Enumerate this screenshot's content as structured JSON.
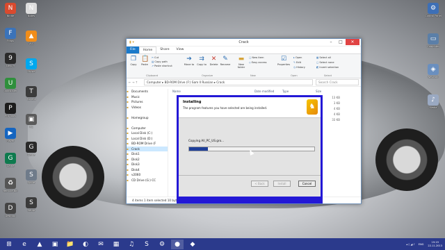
{
  "desktop": {
    "left_icons": [
      {
        "label": "Ninite",
        "glyph": "N",
        "color": "#d94a2e"
      },
      {
        "label": "Fraps",
        "glyph": "F",
        "color": "#3b73b9"
      },
      {
        "label": "Nero 9",
        "glyph": "9",
        "color": "#2a2a2a"
      },
      {
        "label": "uninstaller",
        "glyph": "U",
        "color": "#2f8f3c"
      },
      {
        "label": "Pro Tools",
        "glyph": "P",
        "color": "#1c1c1c"
      },
      {
        "label": "Player",
        "glyph": "▶",
        "color": "#1565c0"
      },
      {
        "label": "Game",
        "glyph": "G",
        "color": "#0e7a4e"
      },
      {
        "label": "Recycle Bin",
        "glyph": "♻",
        "color": "#555"
      },
      {
        "label": "Desktop",
        "glyph": "D",
        "color": "#444"
      }
    ],
    "second_icons": [
      {
        "label": "Notes",
        "glyph": "N",
        "color": "#ddd"
      },
      {
        "label": "VLC",
        "glyph": "▲",
        "color": "#f08d1a"
      },
      {
        "label": "Skype",
        "glyph": "S",
        "color": "#00a8ee"
      },
      {
        "label": "Torrent",
        "glyph": "T",
        "color": "#3c3c3c"
      },
      {
        "label": "PC",
        "glyph": "▣",
        "color": "#5b5b5b"
      },
      {
        "label": "Game",
        "glyph": "G",
        "color": "#2a2a2a"
      },
      {
        "label": "Spore",
        "glyph": "S",
        "color": "#6f7b8a"
      },
      {
        "label": "Setup",
        "glyph": "S",
        "color": "#3b3b3b"
      }
    ],
    "right_icons": [
      {
        "label": "Control Panel",
        "glyph": "⚙",
        "color": "#3d6fb6"
      },
      {
        "label": "Computer",
        "glyph": "▭",
        "color": "#5b7fa8"
      },
      {
        "label": "Network",
        "glyph": "◈",
        "color": "#6a8fbf"
      },
      {
        "label": "Media",
        "glyph": "♪",
        "color": "#9aa9c2"
      }
    ]
  },
  "explorer": {
    "title": "Crack",
    "tabs": [
      "File",
      "Home",
      "Share",
      "View"
    ],
    "selected_tab": "Home",
    "ribbon": {
      "copy": "Copy",
      "paste": "Paste",
      "cut": "Cut",
      "copy_path": "Copy path",
      "paste_shortcut": "Paste shortcut",
      "move_to": "Move to",
      "copy_to": "Copy to",
      "delete": "Delete",
      "rename": "Rename",
      "new_folder": "New folder",
      "new_item": "New item",
      "easy_access": "Easy access",
      "properties": "Properties",
      "open": "Open",
      "edit": "Edit",
      "history": "History",
      "select_all": "Select all",
      "select_none": "Select none",
      "invert_selection": "Invert selection",
      "groups": [
        "Clipboard",
        "Organize",
        "New",
        "Open",
        "Select"
      ]
    },
    "address_path": "Computer  ▸  BD-ROM Drive (F:) Sam II Russian  ▸  Crack",
    "search_placeholder": "Search Crack",
    "nav_items": [
      "Documents",
      "Music",
      "Pictures",
      "Videos",
      "",
      "Homegroup",
      "",
      "Computer",
      "Local Disk (C:)",
      "Local Disk (D:)",
      "BD-ROM Drive (F",
      "Crack",
      "Disk1",
      "Disk2",
      "Disk3",
      "Disk4",
      "v2060",
      "CD Drive (G:) CC"
    ],
    "columns": {
      "name": "Name",
      "date": "Date modified",
      "type": "Type",
      "size": "Size"
    },
    "files": [
      {
        "name": "",
        "size": "13 KB"
      },
      {
        "name": "",
        "size": "3 KB"
      },
      {
        "name": "",
        "size": "4 KB"
      },
      {
        "name": "",
        "size": "4 KB"
      },
      {
        "name": "",
        "size": "33 KB"
      }
    ],
    "status": "4 items     1 item selected  10 byt"
  },
  "installer": {
    "heading": "Installing",
    "subheading": "The program features you have selected are being installed.",
    "status_text": "Copying All_PC_US.gro...",
    "progress": 0.15,
    "back_label": "< Back",
    "install_label": "Install",
    "cancel_label": "Cancel"
  },
  "taskbar": {
    "items": [
      "⊞",
      "e",
      "▲",
      "▣",
      "📁",
      "◐",
      "✉",
      "▦",
      "♫",
      "S",
      "⚙",
      "●",
      "◆"
    ],
    "active_index": 11,
    "tray": {
      "lang": "ENG",
      "time": "19:19",
      "date": "22.11.2013"
    }
  }
}
